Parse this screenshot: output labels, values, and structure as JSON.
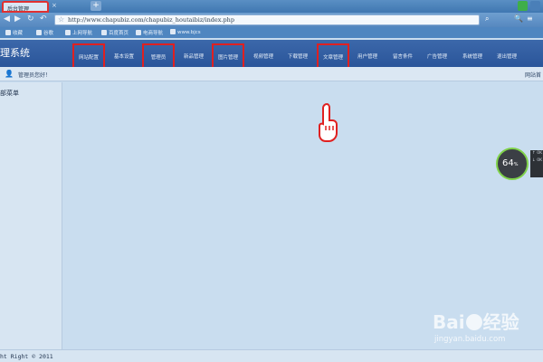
{
  "browser": {
    "tab_title": "后台管理",
    "tab_close": "×",
    "new_tab": "+",
    "url": "http://www.chapubiz.com/chapubiz_houtaibiz/index.php",
    "bookmarks": [
      "收藏",
      "谷歌",
      "上网导航",
      "百度首页",
      "电商导航",
      "www.bjcs"
    ]
  },
  "header": {
    "system_title": "理系统",
    "menu": [
      {
        "label": "网站配置",
        "highlighted": true
      },
      {
        "label": "基本设置",
        "highlighted": false
      },
      {
        "label": "管理员",
        "highlighted": true
      },
      {
        "label": "新品管理",
        "highlighted": false
      },
      {
        "label": "图片管理",
        "highlighted": true
      },
      {
        "label": "视频管理",
        "highlighted": false
      },
      {
        "label": "下载管理",
        "highlighted": false
      },
      {
        "label": "文章管理",
        "highlighted": true
      },
      {
        "label": "用户管理",
        "highlighted": false
      },
      {
        "label": "留言条件",
        "highlighted": false
      },
      {
        "label": "广告管理",
        "highlighted": false
      },
      {
        "label": "系统管理",
        "highlighted": false
      },
      {
        "label": "退出管理",
        "highlighted": false
      }
    ]
  },
  "breadcrumb": {
    "text": "管理员您好！",
    "right_text": "网站首"
  },
  "sidebar": {
    "title": "部菜单"
  },
  "speed_widget": {
    "value": "64",
    "unit": "%",
    "lines": [
      "↑ 0K",
      "↓ 0K"
    ]
  },
  "footer": {
    "text": "ht Right © 2011"
  },
  "watermark": {
    "brand_prefix": "Bai",
    "brand_suffix": "经验",
    "url": "jingyan.baidu.com"
  },
  "colors": {
    "highlight_box": "#e02020",
    "header_bg": "#2a559a",
    "main_bg": "#c9ddef"
  }
}
